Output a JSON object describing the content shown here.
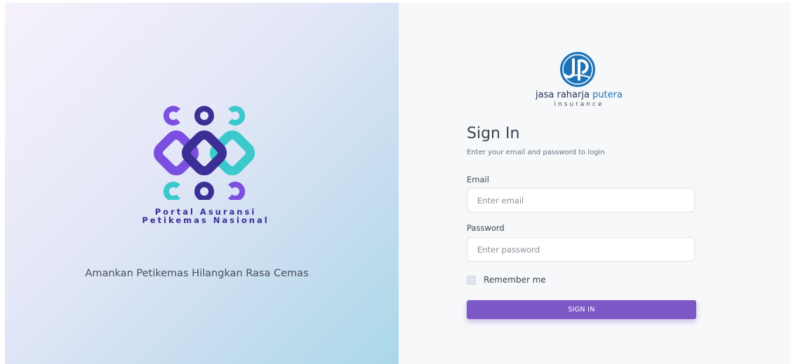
{
  "brand": {
    "name_line1": "Portal Asuransi",
    "name_line2": "Petikemas Nasional",
    "tagline": "Amankan Petikemas Hilangkan Rasa Cemas",
    "colors": {
      "purple": "#7d4fe0",
      "indigo": "#3b2f96",
      "teal": "#3cc9cc"
    }
  },
  "company": {
    "name_part1": "jasa raharja ",
    "name_part2": "putera",
    "sub": "insurance",
    "color": "#1d73b8"
  },
  "login": {
    "title": "Sign In",
    "subtitle": "Enter your email and password to login",
    "email_label": "Email",
    "email_placeholder": "Enter email",
    "email_value": "",
    "password_label": "Password",
    "password_placeholder": "Enter password",
    "password_value": "",
    "remember_label": "Remember me",
    "remember_checked": false,
    "button_label": "SIGN IN",
    "button_color": "#7d58c7"
  }
}
